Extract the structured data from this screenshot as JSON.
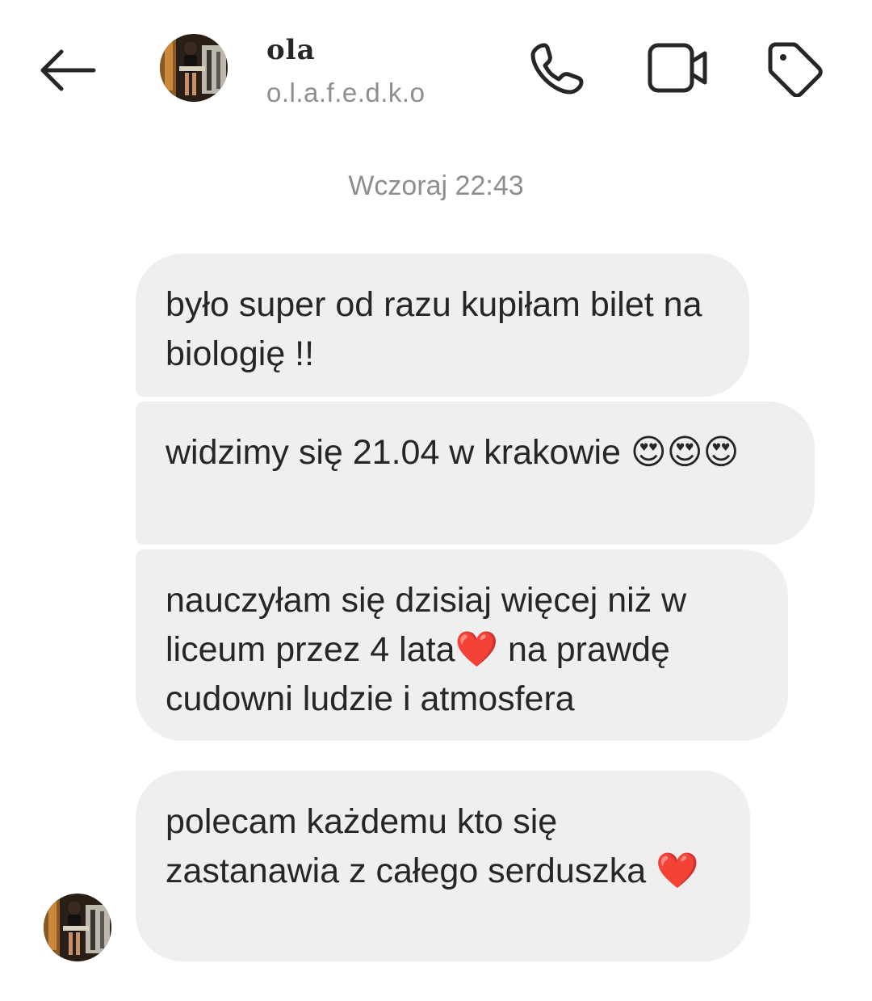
{
  "header": {
    "contact_name": "ola",
    "contact_handle": "o.l.a.f.e.d.k.o",
    "icons": [
      "back-arrow-icon",
      "phone-icon",
      "video-camera-icon",
      "tag-icon"
    ]
  },
  "thread": {
    "timestamp": "Wczoraj 22:43",
    "messages": [
      {
        "text": "było super od razu kupiłam bilet na biologię !!"
      },
      {
        "text": "widzimy się 21.04  w krakowie 😍😍😍"
      },
      {
        "text": "nauczyłam się dzisiaj więcej niż w liceum przez 4 lata❤️ na prawdę cudowni ludzie i atmosfera"
      },
      {
        "text": "polecam każdemu kto się zastanawia  z całego serduszka ❤️"
      }
    ]
  },
  "colors": {
    "bubble_bg": "#efefef",
    "text": "#262626",
    "secondary_text": "#8e8e8e"
  }
}
